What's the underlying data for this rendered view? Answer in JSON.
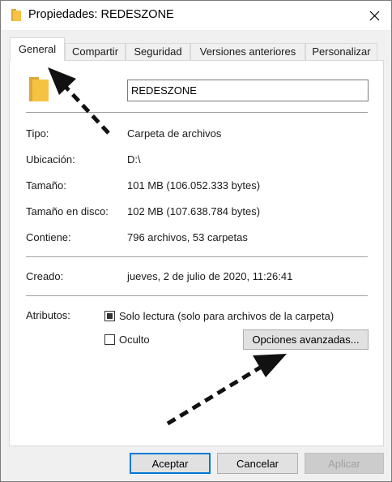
{
  "window": {
    "title": "Propiedades: REDESZONE"
  },
  "tabs": [
    {
      "label": "General",
      "active": true
    },
    {
      "label": "Compartir",
      "active": false
    },
    {
      "label": "Seguridad",
      "active": false
    },
    {
      "label": "Versiones anteriores",
      "active": false
    },
    {
      "label": "Personalizar",
      "active": false
    }
  ],
  "general": {
    "folder_name": "REDESZONE",
    "properties": [
      {
        "label": "Tipo:",
        "value": "Carpeta de archivos"
      },
      {
        "label": "Ubicación:",
        "value": "D:\\"
      },
      {
        "label": "Tamaño:",
        "value": "101 MB (106.052.333 bytes)"
      },
      {
        "label": "Tamaño en disco:",
        "value": "102 MB (107.638.784 bytes)"
      },
      {
        "label": "Contiene:",
        "value": "796 archivos, 53 carpetas"
      }
    ],
    "created_label": "Creado:",
    "created_value": "jueves, 2 de julio de 2020, 11:26:41",
    "attributes_label": "Atributos:",
    "readonly_label": "Solo lectura (solo para archivos de la carpeta)",
    "readonly_state": "indeterminate",
    "hidden_label": "Oculto",
    "hidden_checked": false,
    "advanced_button": "Opciones avanzadas..."
  },
  "footer": {
    "accept": "Aceptar",
    "cancel": "Cancelar",
    "apply": "Aplicar"
  },
  "colors": {
    "folder": "#f5c242",
    "accent": "#0078d7"
  },
  "icons": [
    "folder-icon",
    "close-icon",
    "arrow-annotation"
  ]
}
